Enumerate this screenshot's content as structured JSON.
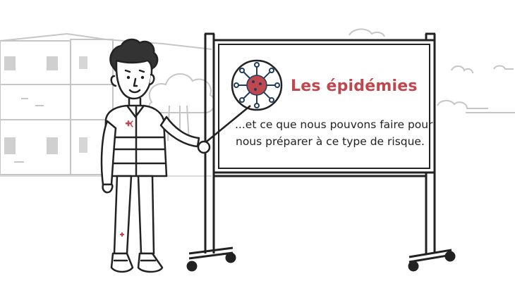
{
  "board": {
    "title": "Les épidémies",
    "subtitle_line1": "...et ce que nous pouvons faire pour",
    "subtitle_line2": "nous préparer à ce type de risque."
  },
  "icons": {
    "virus": "virus-icon",
    "red_cross_badge": "red-cross-icon"
  },
  "colors": {
    "title": "#c0474d",
    "virus_body": "#c0474d",
    "virus_lines": "#1f3c5a",
    "background_sketch": "#c8c8c8",
    "line_art": "#222222"
  }
}
